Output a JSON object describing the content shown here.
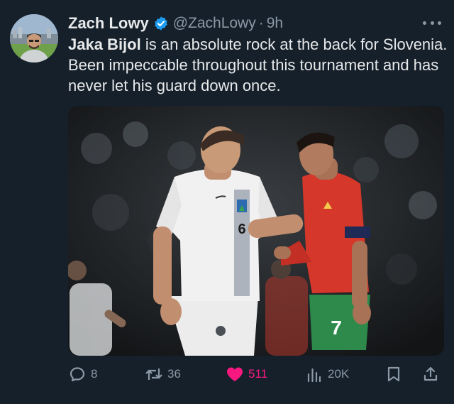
{
  "tweet": {
    "author_name": "Zach Lowy",
    "author_handle": "@ZachLowy",
    "separator": "·",
    "timestamp": "9h",
    "text_bold": "Jaka Bijol",
    "text_rest": " is an absolute rock at the back for Slovenia. Been impeccable throughout this tournament and has never let his guard down once.",
    "image_jersey_number_white": "6",
    "image_jersey_number_red": "7"
  },
  "actions": {
    "replies": "8",
    "retweets": "36",
    "likes": "511",
    "views": "20K"
  },
  "icons": [
    "verified-icon",
    "more-icon",
    "reply-icon",
    "retweet-icon",
    "like-icon",
    "views-icon",
    "bookmark-icon",
    "share-icon"
  ],
  "colors": {
    "background": "#15202b",
    "text": "#e7e9ea",
    "muted": "#8b98a5",
    "like": "#f91880",
    "verified": "#1d9bf0"
  }
}
